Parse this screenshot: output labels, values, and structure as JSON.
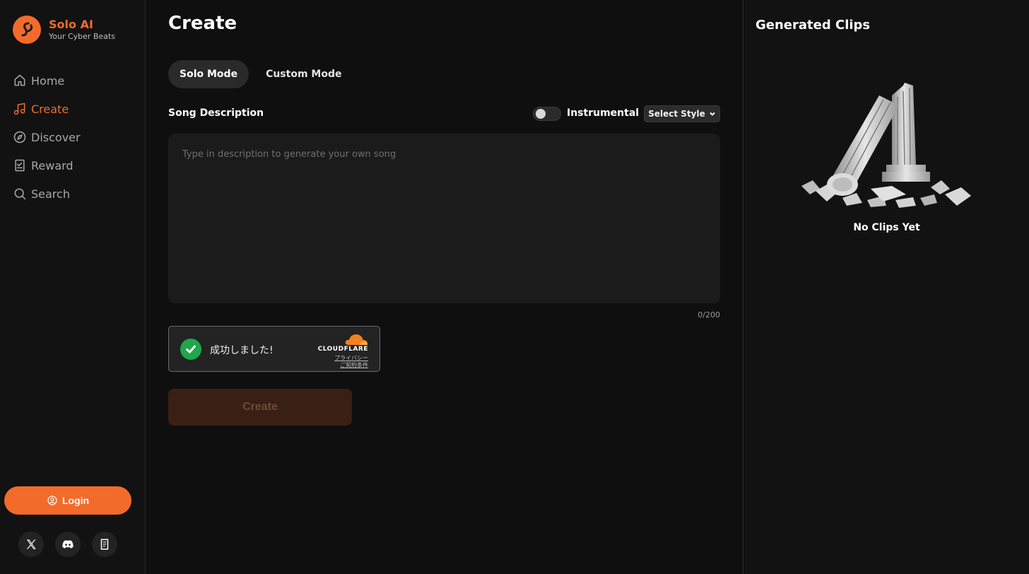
{
  "brand": {
    "name": "Solo AI",
    "tagline": "Your Cyber Beats"
  },
  "nav": [
    {
      "label": "Home",
      "icon": "home-icon",
      "active": false
    },
    {
      "label": "Create",
      "icon": "music-note-icon",
      "active": true
    },
    {
      "label": "Discover",
      "icon": "compass-icon",
      "active": false
    },
    {
      "label": "Reward",
      "icon": "checklist-icon",
      "active": false
    },
    {
      "label": "Search",
      "icon": "search-icon",
      "active": false
    }
  ],
  "login": {
    "label": "Login"
  },
  "socials": [
    "x-icon",
    "discord-icon",
    "docs-icon"
  ],
  "main": {
    "title": "Create",
    "modes": [
      {
        "label": "Solo Mode",
        "active": true
      },
      {
        "label": "Custom Mode",
        "active": false
      }
    ],
    "description_label": "Song Description",
    "instrumental_label": "Instrumental",
    "instrumental_on": false,
    "style_select": "Select Style",
    "description_placeholder": "Type in description to generate your own song",
    "char_count": "0/200",
    "captcha": {
      "status": "成功しました!",
      "provider": "CLOUDFLARE",
      "privacy": "プライバシー",
      "terms": "ご契約条件"
    },
    "create_button": "Create"
  },
  "right": {
    "title": "Generated Clips",
    "empty": "No Clips Yet"
  },
  "colors": {
    "accent": "#f26b2b",
    "background": "#0f0f0f",
    "panel": "#121212",
    "success": "#1fa74a"
  }
}
